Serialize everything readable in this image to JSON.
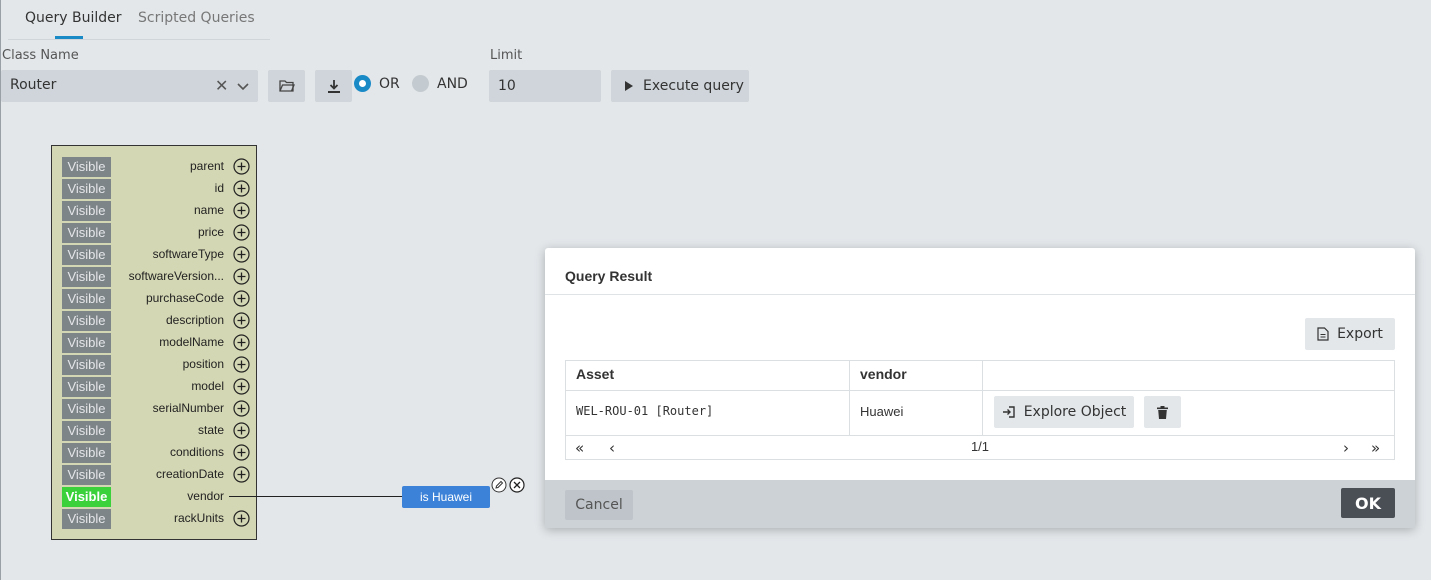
{
  "tabs": [
    {
      "label": "Query Builder",
      "active": true
    },
    {
      "label": "Scripted Queries",
      "active": false
    }
  ],
  "form": {
    "class_name_label": "Class Name",
    "class_name_value": "Router",
    "clear_glyph": "✕",
    "limit_label": "Limit",
    "limit_value": "10",
    "operator_or": "OR",
    "operator_and": "AND",
    "selected_operator": "OR",
    "execute_label": "Execute query"
  },
  "class_box": {
    "attributes": [
      {
        "name": "parent",
        "visibility": "Visible",
        "active": false
      },
      {
        "name": "id",
        "visibility": "Visible",
        "active": false
      },
      {
        "name": "name",
        "visibility": "Visible",
        "active": false
      },
      {
        "name": "price",
        "visibility": "Visible",
        "active": false
      },
      {
        "name": "softwareType",
        "visibility": "Visible",
        "active": false
      },
      {
        "name": "softwareVersion...",
        "visibility": "Visible",
        "active": false
      },
      {
        "name": "purchaseCode",
        "visibility": "Visible",
        "active": false
      },
      {
        "name": "description",
        "visibility": "Visible",
        "active": false
      },
      {
        "name": "modelName",
        "visibility": "Visible",
        "active": false
      },
      {
        "name": "position",
        "visibility": "Visible",
        "active": false
      },
      {
        "name": "model",
        "visibility": "Visible",
        "active": false
      },
      {
        "name": "serialNumber",
        "visibility": "Visible",
        "active": false
      },
      {
        "name": "state",
        "visibility": "Visible",
        "active": false
      },
      {
        "name": "conditions",
        "visibility": "Visible",
        "active": false
      },
      {
        "name": "creationDate",
        "visibility": "Visible",
        "active": false
      },
      {
        "name": "vendor",
        "visibility": "Visible",
        "active": true
      },
      {
        "name": "rackUnits",
        "visibility": "Visible",
        "active": false
      }
    ],
    "filter_label": "is Huawei"
  },
  "dialog": {
    "title": "Query Result",
    "export_label": "Export",
    "columns": [
      "Asset",
      "vendor"
    ],
    "rows": [
      {
        "asset": "WEL-ROU-01 [Router]",
        "vendor": "Huawei",
        "explore_label": "Explore Object"
      }
    ],
    "pagination": {
      "page_label": "1/1",
      "first": "«",
      "prev": "‹",
      "next": "›",
      "last": "»"
    },
    "cancel_label": "Cancel",
    "ok_label": "OK"
  },
  "colors": {
    "accent": "#1a8ac7",
    "visible_active": "#3ad13a",
    "filter_pill": "#3b82d8",
    "class_box_bg": "#d4d7b3",
    "ok_button": "#4a4e55"
  },
  "icons": [
    "folder-open-icon",
    "download-icon",
    "play-icon",
    "plus-circle-icon",
    "edit-icon",
    "close-circle-icon",
    "file-icon",
    "sign-in-icon",
    "trash-icon",
    "chevron-down-icon"
  ]
}
